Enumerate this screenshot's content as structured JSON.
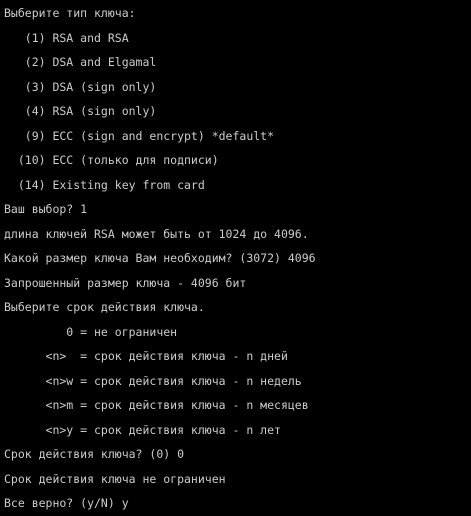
{
  "terminal": {
    "lines": [
      "Выберите тип ключа:",
      "   (1) RSA and RSA",
      "   (2) DSA and Elgamal",
      "   (3) DSA (sign only)",
      "   (4) RSA (sign only)",
      "   (9) ECC (sign and encrypt) *default*",
      "  (10) ECC (только для подписи)",
      "  (14) Existing key from card",
      "Ваш выбор? 1",
      "длина ключей RSA может быть от 1024 до 4096.",
      "Какой размер ключа Вам необходим? (3072) 4096",
      "Запрошенный размер ключа - 4096 бит",
      "Выберите срок действия ключа.",
      "         0 = не ограничен",
      "      <n>  = срок действия ключа - n дней",
      "      <n>w = срок действия ключа - n недель",
      "      <n>m = срок действия ключа - n месяцев",
      "      <n>y = срок действия ключа - n лет",
      "Срок действия ключа? (0) 0",
      "Срок действия ключа не ограничен",
      "Все верно? (y/N) y"
    ]
  }
}
